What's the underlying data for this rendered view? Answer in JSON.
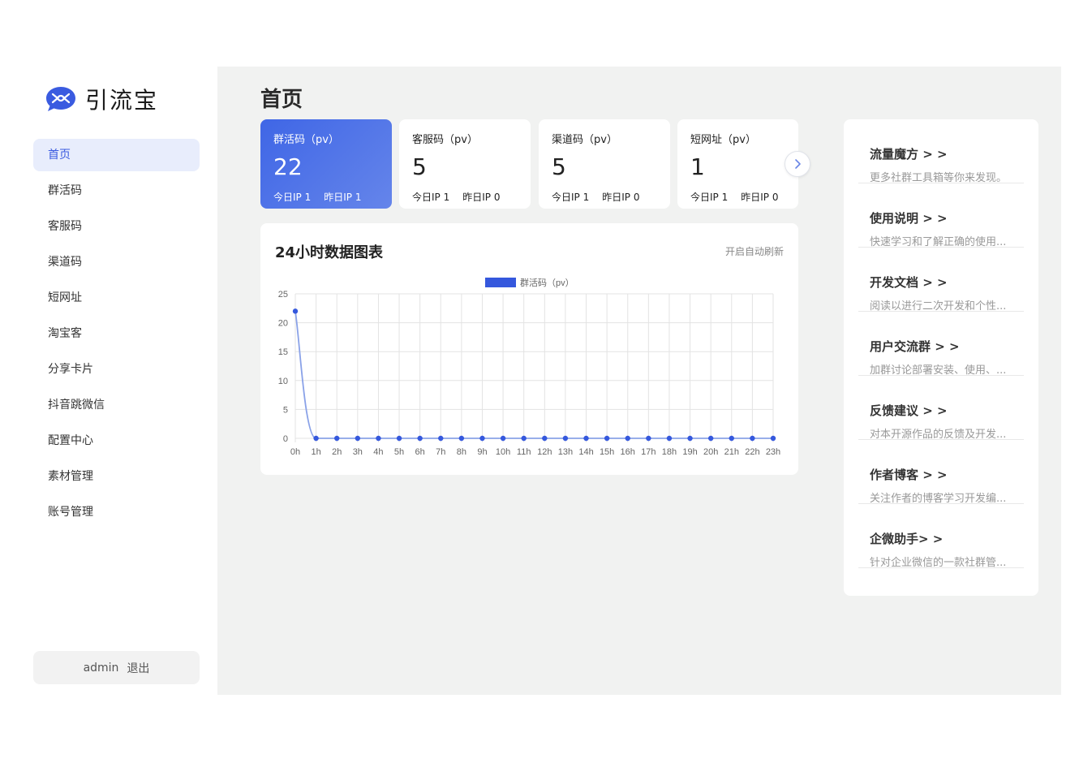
{
  "app": {
    "name": "引流宝"
  },
  "sidebar": {
    "items": [
      {
        "label": "首页",
        "active": true
      },
      {
        "label": "群活码"
      },
      {
        "label": "客服码"
      },
      {
        "label": "渠道码"
      },
      {
        "label": "短网址"
      },
      {
        "label": "淘宝客"
      },
      {
        "label": "分享卡片"
      },
      {
        "label": "抖音跳微信"
      },
      {
        "label": "配置中心"
      },
      {
        "label": "素材管理"
      },
      {
        "label": "账号管理"
      }
    ],
    "account": {
      "username": "admin",
      "logout_label": "退出"
    }
  },
  "main": {
    "title": "首页",
    "stats": [
      {
        "name": "群活码（pv）",
        "value": "22",
        "today_ip": "今日IP 1",
        "yesterday_ip": "昨日IP 1"
      },
      {
        "name": "客服码（pv）",
        "value": "5",
        "today_ip": "今日IP 1",
        "yesterday_ip": "昨日IP 0"
      },
      {
        "name": "渠道码（pv）",
        "value": "5",
        "today_ip": "今日IP 1",
        "yesterday_ip": "昨日IP 0"
      },
      {
        "name": "短网址（pv）",
        "value": "1",
        "today_ip": "今日IP 1",
        "yesterday_ip": "昨日IP 0"
      }
    ],
    "chart_panel": {
      "title": "24小时数据图表",
      "refresh_label": "开启自动刷新"
    },
    "links": [
      {
        "title": "流量魔方 > >",
        "desc": "更多社群工具箱等你来发现。"
      },
      {
        "title": "使用说明 > >",
        "desc": "快速学习和了解正确的使用..."
      },
      {
        "title": "开发文档 > >",
        "desc": "阅读以进行二次开发和个性..."
      },
      {
        "title": "用户交流群 > >",
        "desc": "加群讨论部署安装、使用、..."
      },
      {
        "title": "反馈建议 > >",
        "desc": "对本开源作品的反馈及开发..."
      },
      {
        "title": "作者博客 > >",
        "desc": "关注作者的博客学习开发编..."
      },
      {
        "title": "企微助手> >",
        "desc": "针对企业微信的一款社群管..."
      }
    ]
  },
  "colors": {
    "accent": "#3a5be0",
    "line": "#8aa2e8",
    "point": "#3558dd"
  },
  "chart_data": {
    "type": "line",
    "x": [
      "0h",
      "1h",
      "2h",
      "3h",
      "4h",
      "5h",
      "6h",
      "7h",
      "8h",
      "9h",
      "10h",
      "11h",
      "12h",
      "13h",
      "14h",
      "15h",
      "16h",
      "17h",
      "18h",
      "19h",
      "20h",
      "21h",
      "22h",
      "23h"
    ],
    "series": [
      {
        "name": "群活码（pv）",
        "values": [
          22,
          0,
          0,
          0,
          0,
          0,
          0,
          0,
          0,
          0,
          0,
          0,
          0,
          0,
          0,
          0,
          0,
          0,
          0,
          0,
          0,
          0,
          0,
          0
        ]
      }
    ],
    "ylim": [
      0,
      25
    ],
    "yticks": [
      0,
      5,
      10,
      15,
      20,
      25
    ],
    "grid": true,
    "legend": "top-center"
  }
}
